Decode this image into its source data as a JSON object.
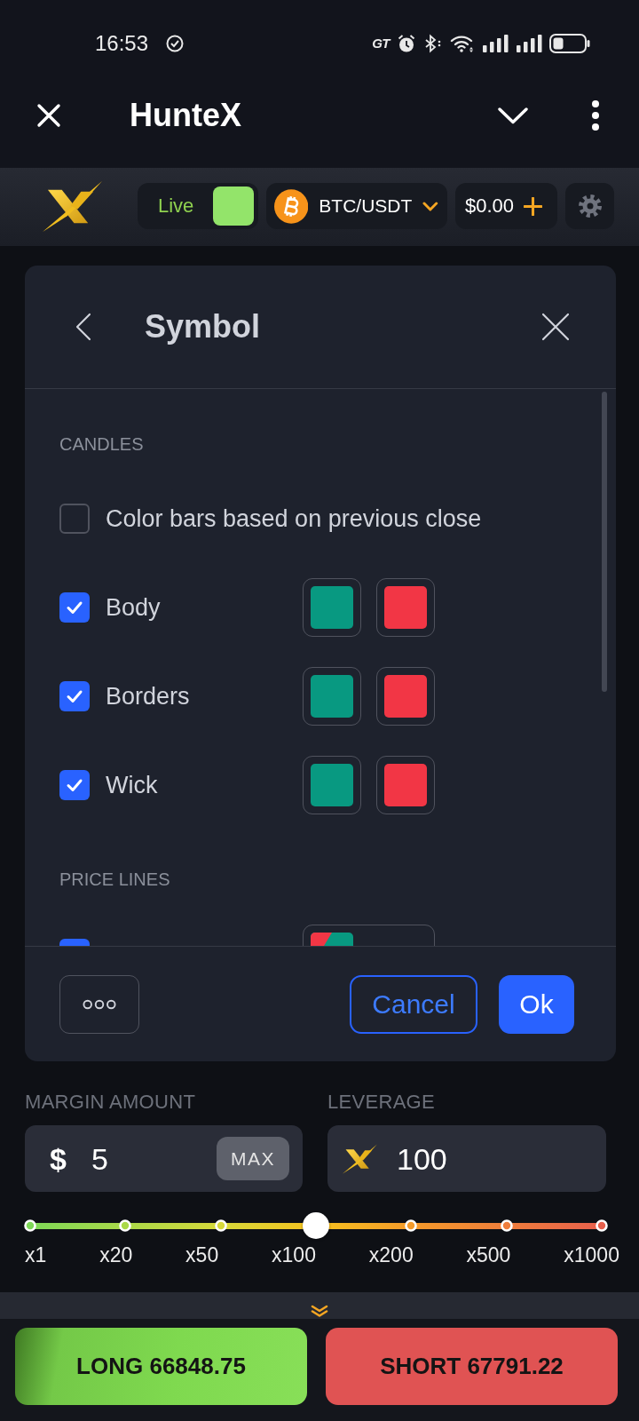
{
  "status_bar": {
    "time": "16:53",
    "network_badge": "GT"
  },
  "app_bar": {
    "title": "HunteX"
  },
  "toolbar": {
    "mode": {
      "label": "Live",
      "on": true
    },
    "symbol": "BTC/USDT",
    "balance": "$0.00"
  },
  "dialog": {
    "title": "Symbol",
    "sections": [
      {
        "heading": "CANDLES",
        "rows": [
          {
            "kind": "checkbox",
            "label": "Color bars based on previous close",
            "checked": false
          },
          {
            "kind": "colors",
            "label": "Body",
            "checked": true,
            "swatches": [
              {
                "color": "#089981"
              },
              {
                "color": "#f23645"
              }
            ]
          },
          {
            "kind": "colors",
            "label": "Borders",
            "checked": true,
            "swatches": [
              {
                "color": "#089981"
              },
              {
                "color": "#f23645"
              }
            ]
          },
          {
            "kind": "colors",
            "label": "Wick",
            "checked": true,
            "swatches": [
              {
                "color": "#089981"
              },
              {
                "color": "#f23645"
              }
            ]
          }
        ]
      },
      {
        "heading": "PRICE LINES",
        "rows": [
          {
            "kind": "line",
            "checked": true,
            "swatches": [
              {
                "color": "#f23645"
              },
              {
                "color": "#089981"
              }
            ]
          }
        ]
      }
    ],
    "buttons": [
      {
        "kind": "more"
      },
      {
        "kind": "outline",
        "label": "Cancel"
      },
      {
        "kind": "primary",
        "label": "Ok"
      }
    ]
  },
  "order_form": {
    "margin_amount": {
      "label": "MARGIN AMOUNT",
      "currency": "$",
      "value": "5",
      "max_button": "MAX"
    },
    "leverage": {
      "label": "LEVERAGE",
      "value": "100"
    },
    "leverage_slider": {
      "level": 0.5,
      "stops": [
        "x1",
        "x20",
        "x50",
        "x100",
        "x200",
        "x500",
        "x1000"
      ]
    }
  },
  "actions": [
    {
      "kind": "long",
      "label": "LONG 66848.75"
    },
    {
      "kind": "short",
      "label": "SHORT 67791.22"
    }
  ]
}
